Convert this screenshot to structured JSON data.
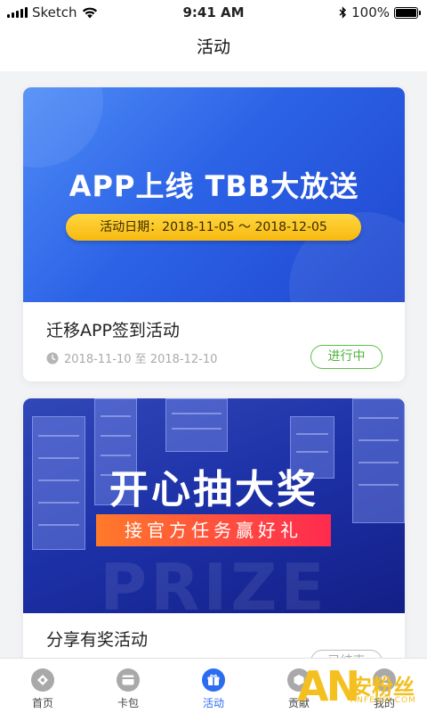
{
  "status_bar": {
    "carrier": "Sketch",
    "time": "9:41 AM",
    "battery": "100%",
    "battery_level": 1.0
  },
  "nav": {
    "title": "活动"
  },
  "activities": [
    {
      "banner_title": "APP上线 TBB大放送",
      "banner_subtitle": "活动日期：2018-11-05 ～ 2018-12-05",
      "title": "迁移APP签到活动",
      "date_range": "2018-11-10 至 2018-12-10",
      "status": "进行中",
      "status_color": "#4fb23e"
    },
    {
      "banner_title": "开心抽大奖",
      "banner_subtitle": "接官方任务赢好礼",
      "banner_bg_text": "PRIZE",
      "title": "分享有奖活动",
      "status": "已结束"
    }
  ],
  "tabs": [
    {
      "label": "首页",
      "icon": "home-icon",
      "active": false
    },
    {
      "label": "卡包",
      "icon": "wallet-icon",
      "active": false
    },
    {
      "label": "活动",
      "icon": "gift-icon",
      "active": true
    },
    {
      "label": "贡献",
      "icon": "contribute-icon",
      "active": false
    },
    {
      "label": "我的",
      "icon": "profile-icon",
      "active": false
    }
  ],
  "watermark": {
    "logo": "AN",
    "text": "安粉丝",
    "url": "ANFENSI.COM"
  },
  "colors": {
    "accent": "#2b6df0",
    "status_active": "#4fb23e",
    "pill_yellow": "#f7b90f",
    "ribbon": "#ff2a4f"
  }
}
